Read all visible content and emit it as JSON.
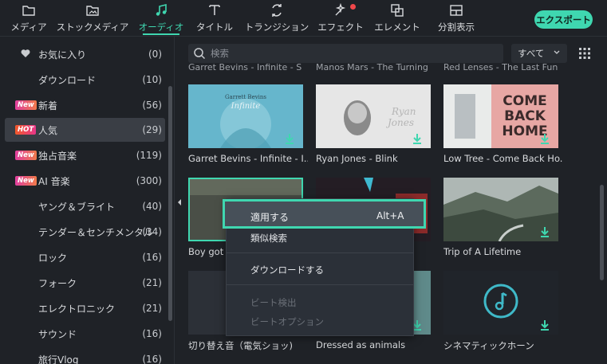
{
  "toolbar": {
    "items": [
      {
        "label": "メディア",
        "icon": "folder-icon"
      },
      {
        "label": "ストックメディア",
        "icon": "stock-media-icon"
      },
      {
        "label": "オーディオ",
        "icon": "music-note-icon",
        "active": true
      },
      {
        "label": "タイトル",
        "icon": "text-icon"
      },
      {
        "label": "トランジション",
        "icon": "transition-icon"
      },
      {
        "label": "エフェクト",
        "icon": "effects-icon",
        "notification": true
      },
      {
        "label": "エレメント",
        "icon": "elements-icon"
      },
      {
        "label": "分割表示",
        "icon": "split-screen-icon"
      }
    ],
    "export_label": "エクスポート"
  },
  "sidebar": {
    "items": [
      {
        "label": "お気に入り",
        "count": "(0)",
        "icon": "heart-icon"
      },
      {
        "label": "ダウンロード",
        "count": "(10)"
      },
      {
        "label": "新着",
        "count": "(56)",
        "badge": "New"
      },
      {
        "label": "人気",
        "count": "(29)",
        "badge": "HOT",
        "selected": true
      },
      {
        "label": "独占音楽",
        "count": "(119)",
        "badge": "New"
      },
      {
        "label": "AI 音楽",
        "count": "(300)",
        "badge": "New"
      },
      {
        "label": "ヤング＆ブライト",
        "count": "(40)"
      },
      {
        "label": "テンダー＆センチメンタル",
        "count": "(34)"
      },
      {
        "label": "ロック",
        "count": "(16)"
      },
      {
        "label": "フォーク",
        "count": "(21)"
      },
      {
        "label": "エレクトロニック",
        "count": "(21)"
      },
      {
        "label": "サウンド",
        "count": "(16)"
      },
      {
        "label": "旅行Vlog",
        "count": "(16)"
      }
    ]
  },
  "search": {
    "placeholder": "検索"
  },
  "filter": {
    "selected": "すべて"
  },
  "top_row_cut": [
    "Garret Bevins - Infinite - Sli",
    "Manos Mars - The Turning",
    "Red Lenses - The Last Fun"
  ],
  "cards": [
    {
      "title": "Garret Bevins - Infinite - I...",
      "art_text": "Garrett Bevins",
      "art_text2": "Infinite"
    },
    {
      "title": "Ryan Jones - Blink",
      "art_text": "Ryan",
      "art_text2": "Jones"
    },
    {
      "title": "Low Tree - Come Back Ho...",
      "art_text": "COME",
      "art_text2": "BACK",
      "art_text3": "HOME"
    },
    {
      "title": "Boy got s"
    },
    {
      "title": ""
    },
    {
      "title": "Trip of A Lifetime"
    },
    {
      "title": "切り替え音（電気ショッ)"
    },
    {
      "title": "Dressed as animals"
    },
    {
      "title": "シネマティックホーン"
    }
  ],
  "context_menu": {
    "apply_label": "適用する",
    "apply_shortcut": "Alt+A",
    "similar_search": "類似検索",
    "download": "ダウンロードする",
    "beat_detect": "ビート検出",
    "beat_options": "ビートオプション"
  },
  "colors": {
    "accent": "#3fd7b0",
    "background": "#1f2227",
    "notification": "#f0474a"
  }
}
